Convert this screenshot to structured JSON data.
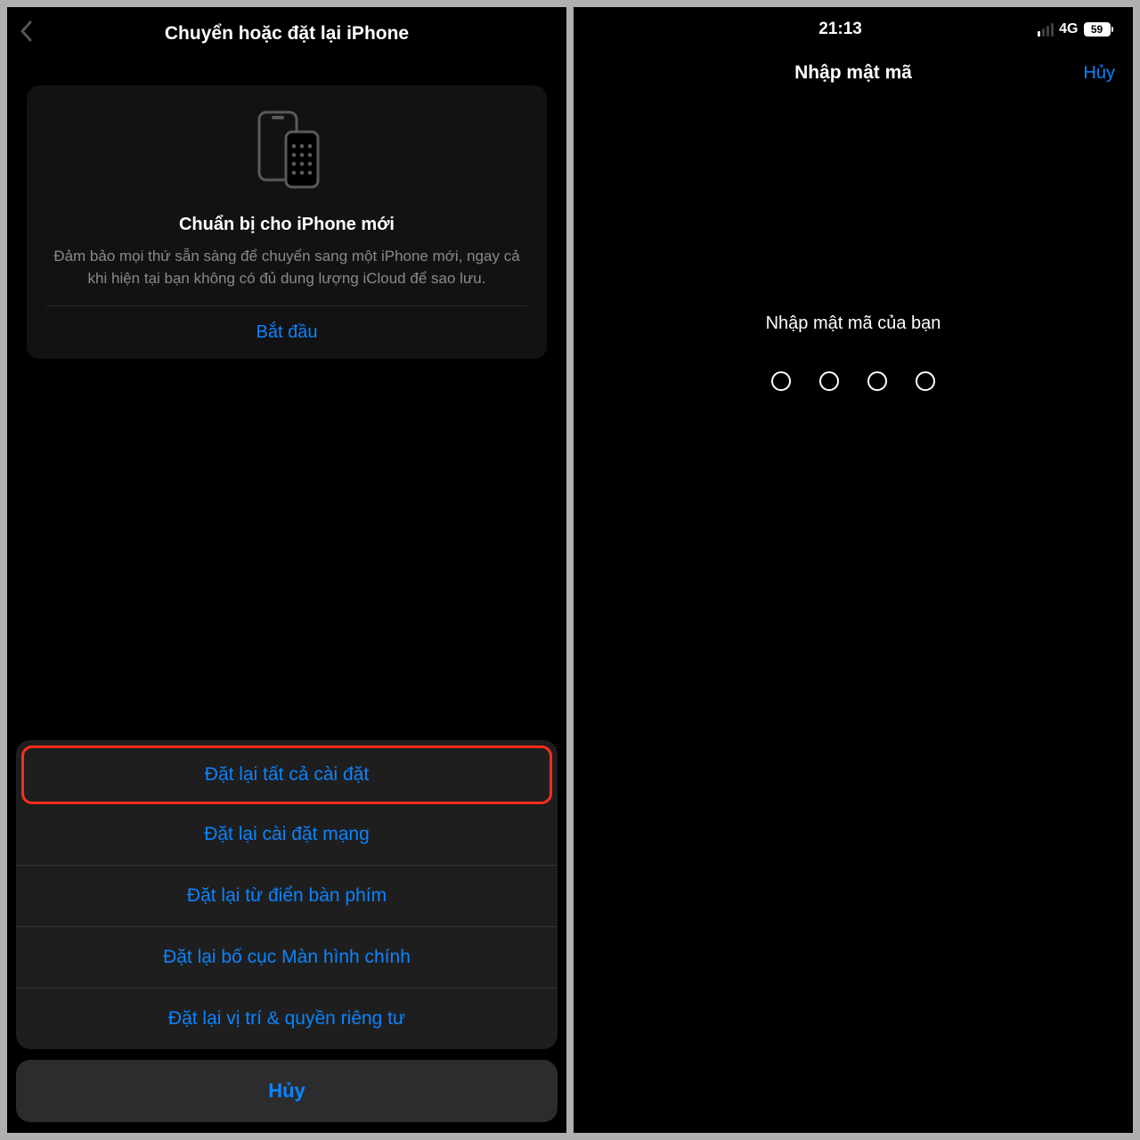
{
  "left": {
    "headerTitle": "Chuyển hoặc đặt lại iPhone",
    "card": {
      "title": "Chuẩn bị cho iPhone mới",
      "desc": "Đảm bảo mọi thứ sẵn sàng để chuyển sang một iPhone mới, ngay cả khi hiện tại bạn không có đủ dung lượng iCloud để sao lưu.",
      "action": "Bắt đầu"
    },
    "sheet": {
      "items": [
        "Đặt lại tất cả cài đặt",
        "Đặt lại cài đặt mạng",
        "Đặt lại từ điển bàn phím",
        "Đặt lại bố cục Màn hình chính",
        "Đặt lại vị trí & quyền riêng tư"
      ],
      "cancel": "Hủy"
    }
  },
  "right": {
    "status": {
      "time": "21:13",
      "network": "4G",
      "battery": "59"
    },
    "nav": {
      "title": "Nhập mật mã",
      "cancel": "Hủy"
    },
    "prompt": "Nhập mật mã của bạn"
  }
}
